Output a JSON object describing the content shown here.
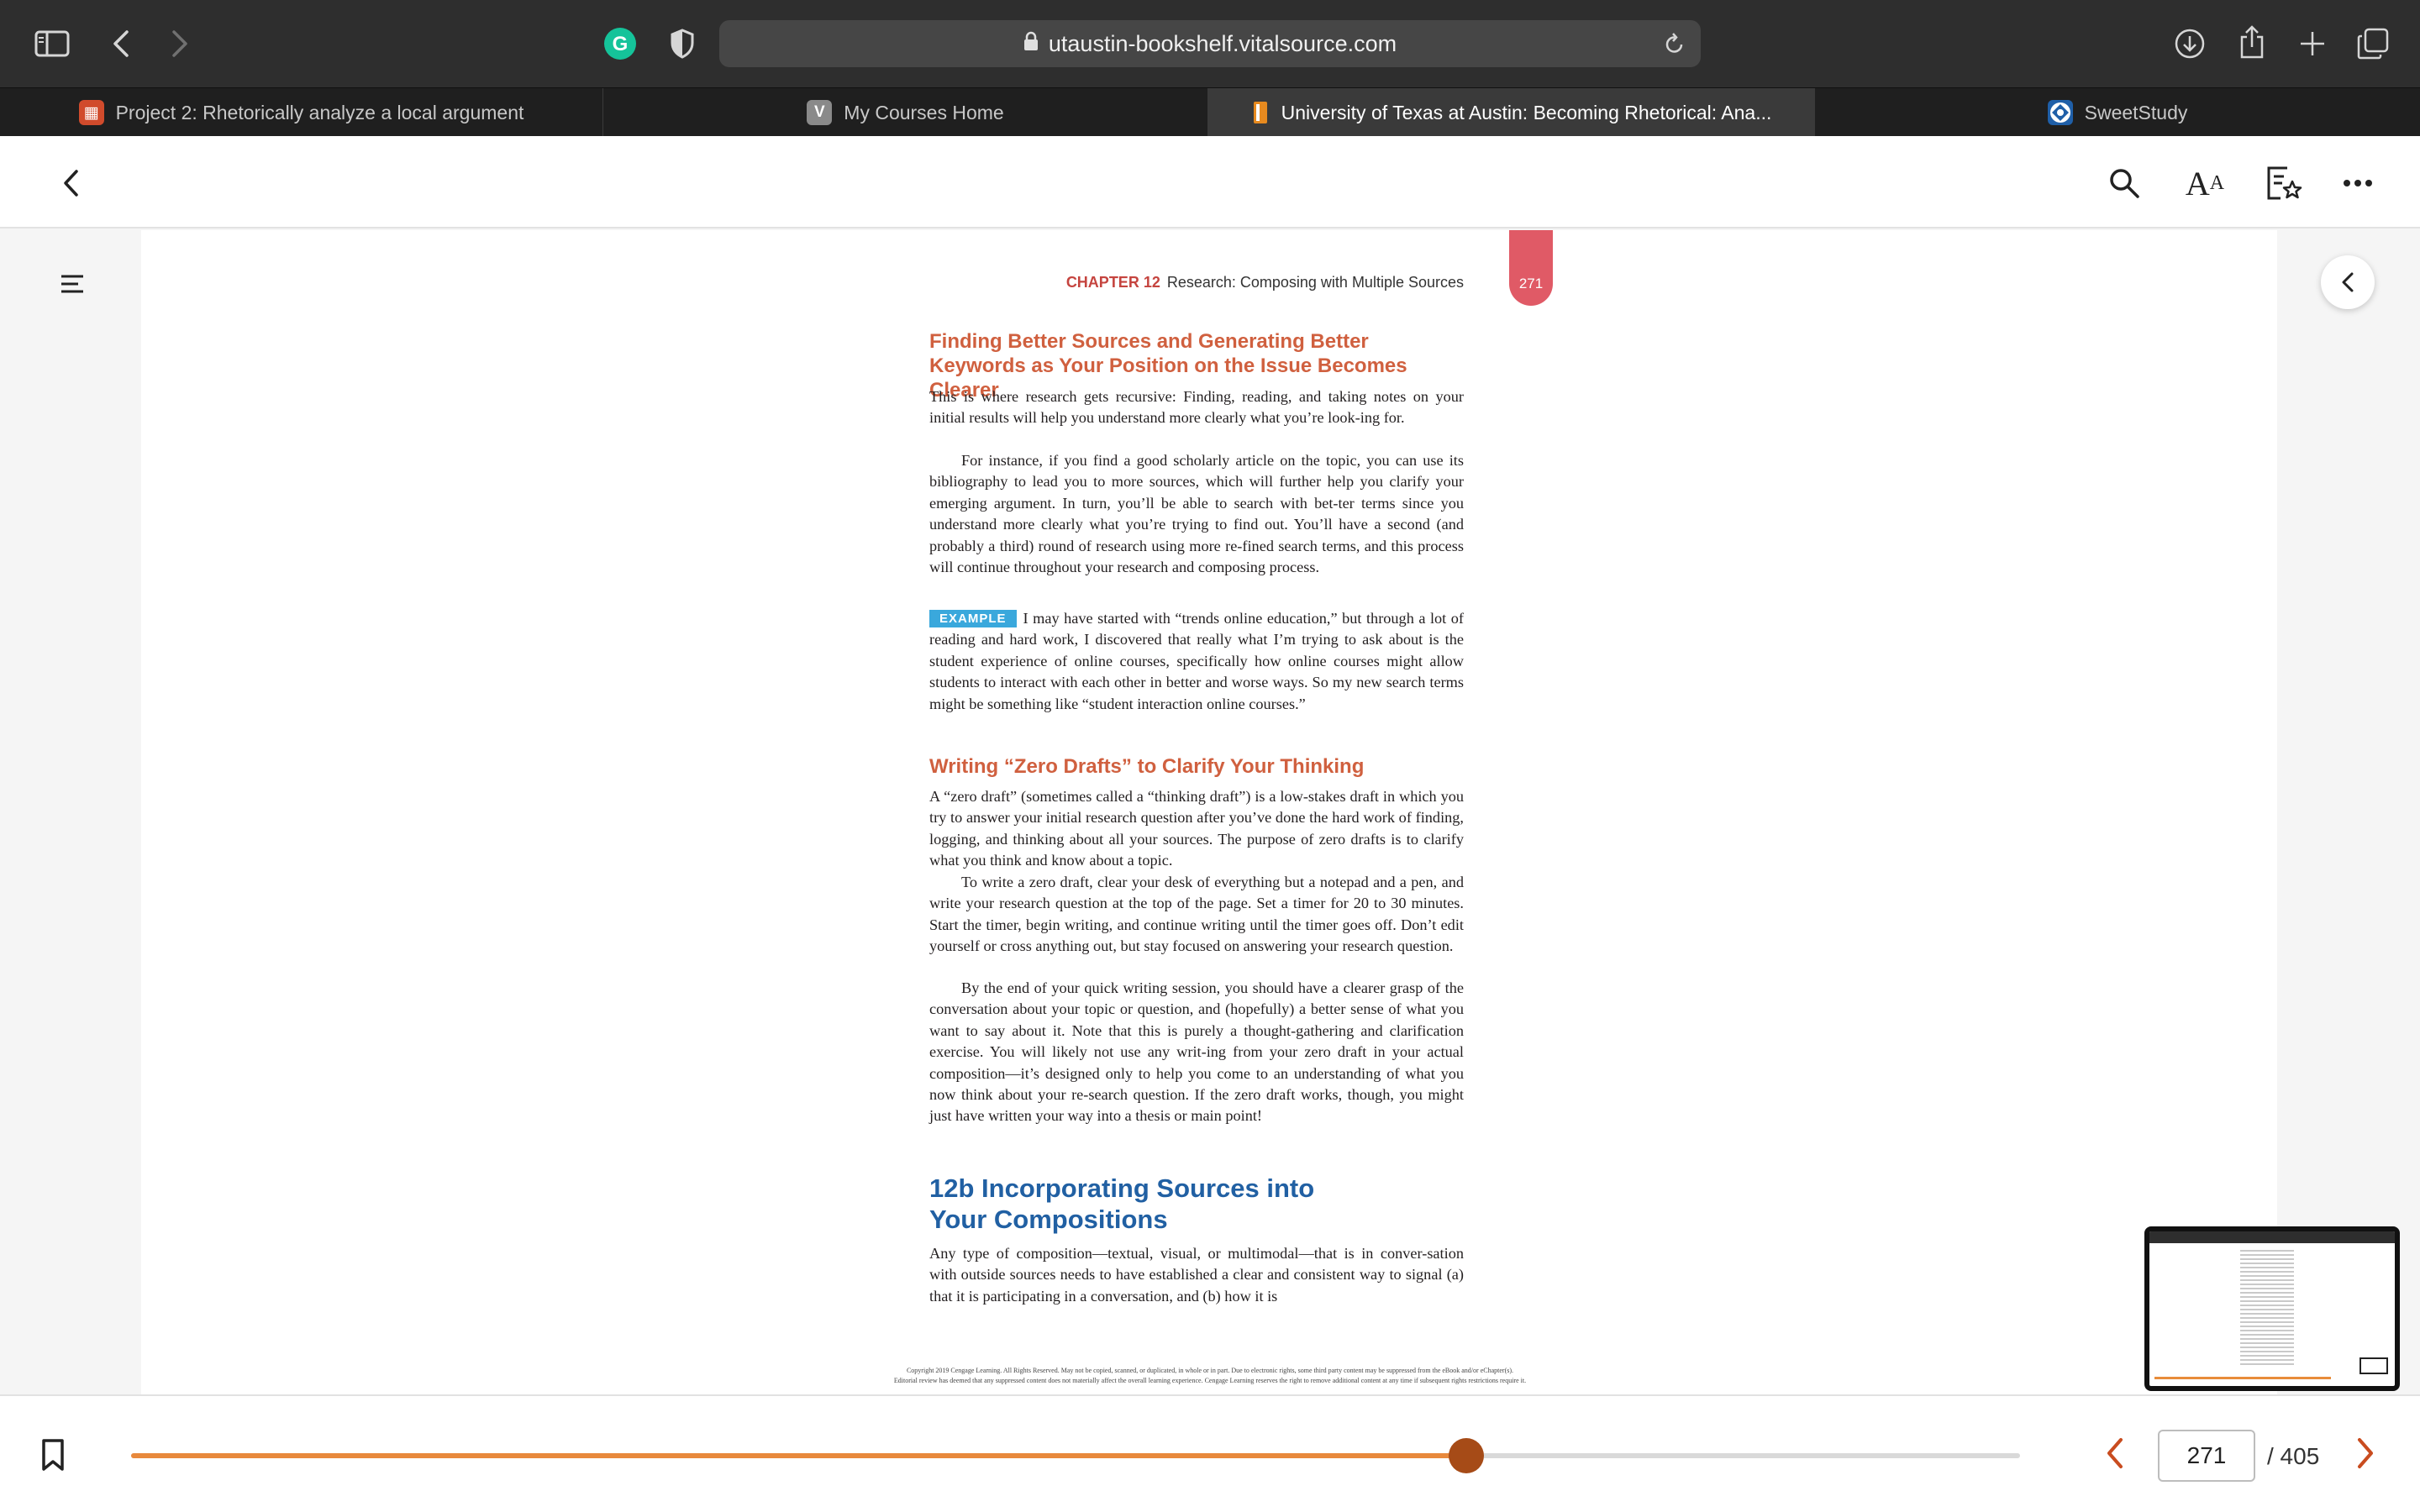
{
  "browser": {
    "url": "utaustin-bookshelf.vitalsource.com",
    "tabs": [
      {
        "label": "Project 2: Rhetorically analyze a local argument",
        "icon": "canvas-icon",
        "color": "#d14b2c"
      },
      {
        "label": "My Courses Home",
        "icon": "v-icon",
        "badge": "V",
        "color": "#8a8a8a"
      },
      {
        "label": "University of Texas at Austin: Becoming Rhetorical: Ana...",
        "icon": "bookshelf-icon",
        "color": "#e78a1f"
      },
      {
        "label": "SweetStudy",
        "icon": "sweetstudy-icon",
        "color": "#1f5fa8"
      }
    ]
  },
  "book": {
    "chapter_label": "CHAPTER 12",
    "chapter_title": "Research: Composing with Multiple Sources",
    "page_number": "271",
    "heading1": "Finding Better Sources and Generating Better Keywords as Your Position on the Issue Becomes Clearer",
    "p1": "This is where research gets recursive: Finding, reading, and taking notes on your initial results will help you understand more clearly what you’re look-ing for.",
    "p2": "For instance, if you find a good scholarly article on the topic, you can use its bibliography to lead you to more sources, which will further help you clarify your emerging argument. In turn, you’ll be able to search with bet-ter terms since you understand more clearly what you’re trying to find out. You’ll have a second (and probably a third) round of research using more re-fined search terms, and this process will continue throughout your research and composing process.",
    "example_tag": "EXAMPLE",
    "example_text": "I may have started with “trends online education,” but through a lot of reading and hard work, I discovered that really what I’m trying to ask about is the student experience of online courses, specifically how online courses might allow students to interact with each other in better and worse ways. So my new search terms might be something like “student interaction online courses.”",
    "heading2": "Writing “Zero Drafts” to Clarify Your Thinking",
    "p3": "A “zero draft” (sometimes called a “thinking draft”) is a low-stakes draft in which you try to answer your initial research question after you’ve done the hard work of finding, logging, and thinking about all your sources. The purpose of zero drafts is to clarify what you think and know about a topic.",
    "p4": "To write a zero draft, clear your desk of everything but a notepad and a pen, and write your research question at the top of the page. Set a timer for 20 to 30 minutes. Start the timer, begin writing, and continue writing until the timer goes off. Don’t edit yourself or cross anything out, but stay focused on answering your research question.",
    "p5": "By the end of your quick writing session, you should have a clearer grasp of the conversation about your topic or question, and (hopefully) a better sense of what you want to say about it. Note that this is purely a thought-gathering and clarification exercise. You will likely not use any writ-ing from your zero draft in your actual composition—it’s designed only to help you come to an understanding of what you now think about your re-search question. If the zero draft works, though, you might just have written your way into a thesis or main point!",
    "heading3": "12b Incorporating Sources into Your Compositions",
    "p6": "Any type of composition—textual, visual, or multimodal—that is in conver-sation with outside sources needs to have established a clear and consistent way to signal (a) that it is participating in a conversation, and (b) how it is",
    "copyright_line1": "Copyright 2019 Cengage Learning. All Rights Reserved. May not be copied, scanned, or duplicated, in whole or in part. Due to electronic rights, some third party content may be suppressed from the eBook and/or eChapter(s).",
    "copyright_line2": "Editorial review has deemed that any suppressed content does not materially affect the overall learning experience. Cengage Learning reserves the right to remove additional content at any time if subsequent rights restrictions require it."
  },
  "navigation": {
    "current_page": "271",
    "total_pages": "/ 405",
    "progress": 0.7068
  },
  "colors": {
    "accent": "#e8893c",
    "knob": "#a64b17",
    "chapter_red": "#c5443f",
    "heading_blue": "#2160a3"
  }
}
